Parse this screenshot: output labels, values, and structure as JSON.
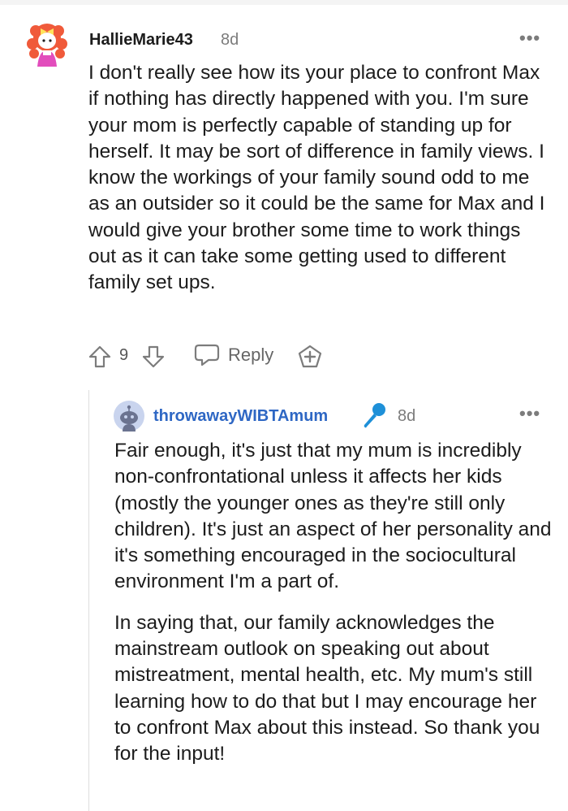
{
  "comment1": {
    "author": "HallieMarie43",
    "age": "8d",
    "more": "•••",
    "text": "I don't really see how its your place to confront Max if nothing has directly happened with you. I'm sure your mom is perfectly capable of standing up for herself. It may be sort of difference in family views. I know the workings of your family sound odd to me as an outsider so it could be the same for Max and I would give your brother some time to work things out as it can take some getting used to different family set ups.",
    "score": "9",
    "reply_label": "Reply"
  },
  "comment2": {
    "author": "throwawayWIBTAmum",
    "age": "8d",
    "more": "•••",
    "paragraphs": [
      "Fair enough, it's just that my mum is incredibly non-confrontational unless it affects her kids (mostly the younger ones as they're still only children). It's just an aspect of her personality and it's something encouraged in the sociocultural environment I'm a part of.",
      "In saying that, our family acknowledges the mainstream outlook on speaking out about mistreatment, mental health, etc. My mum's still learning how to do that but I may encourage her to confront Max about this instead. So thank you for the input!"
    ]
  },
  "icons": [
    "avatar",
    "more-options-icon",
    "upvote-icon",
    "downvote-icon",
    "reply-icon",
    "award-icon",
    "op-mic-icon"
  ],
  "colors": {
    "username_op": "#2e67c4",
    "mic": "#1e90d8",
    "muted": "#7c7c7c",
    "text": "#1c1c1c"
  }
}
